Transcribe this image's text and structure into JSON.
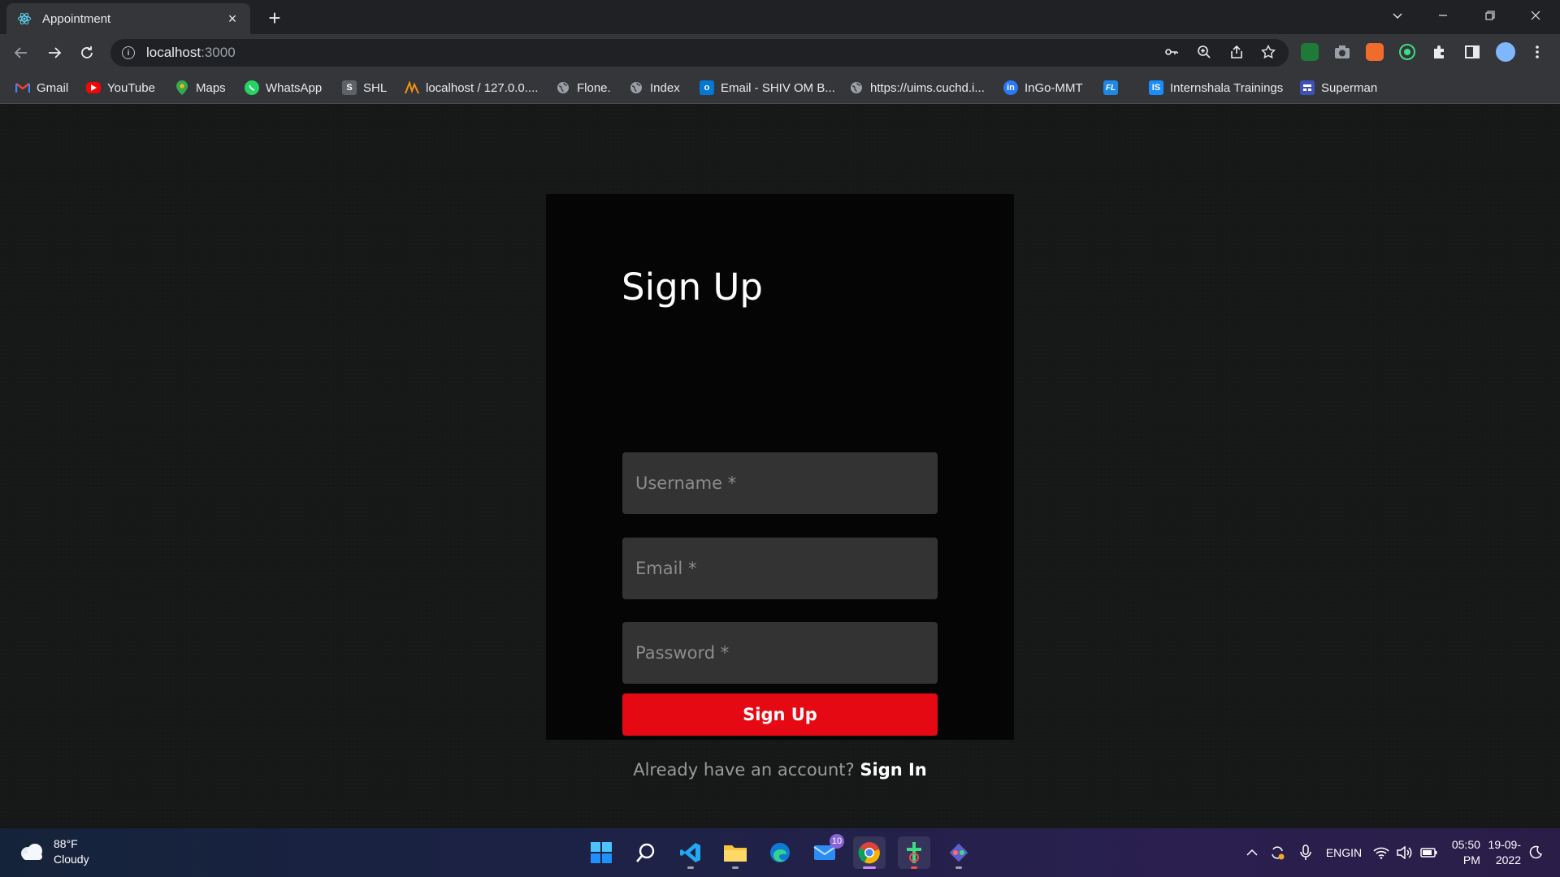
{
  "browser": {
    "tab_title": "Appointment",
    "tab_close": "×",
    "new_tab": "+",
    "url_host": "localhost",
    "url_port": ":3000"
  },
  "bookmarks": [
    {
      "label": "Gmail",
      "icon": "gmail-icon",
      "color": "#ea4335"
    },
    {
      "label": "YouTube",
      "icon": "youtube-icon",
      "color": "#ff0000"
    },
    {
      "label": "Maps",
      "icon": "maps-icon",
      "color": "#34a853"
    },
    {
      "label": "WhatsApp",
      "icon": "whatsapp-icon",
      "color": "#25d366"
    },
    {
      "label": "SHL",
      "icon": "shl-icon",
      "color": "#5f6368"
    },
    {
      "label": "localhost / 127.0.0....",
      "icon": "phpmyadmin-icon",
      "color": "#f29111"
    },
    {
      "label": "Flone.",
      "icon": "globe-icon",
      "color": "#9aa0a6"
    },
    {
      "label": "Index",
      "icon": "globe-icon",
      "color": "#9aa0a6"
    },
    {
      "label": "Email - SHIV OM B...",
      "icon": "outlook-icon",
      "color": "#0078d4"
    },
    {
      "label": "https://uims.cuchd.i...",
      "icon": "globe-icon",
      "color": "#9aa0a6"
    },
    {
      "label": "InGo-MMT",
      "icon": "ingo-icon",
      "color": "#2979ff"
    },
    {
      "label": "",
      "icon": "fl-icon",
      "color": "#1e88e5"
    },
    {
      "label": "Internshala Trainings",
      "icon": "internshala-icon",
      "color": "#1a8cff"
    },
    {
      "label": "Superman",
      "icon": "superman-icon",
      "color": "#3f51b5"
    }
  ],
  "form": {
    "title": "Sign Up",
    "username_placeholder": "Username *",
    "email_placeholder": "Email *",
    "password_placeholder": "Password *",
    "submit_label": "Sign Up",
    "account_prompt": "Already have an account?",
    "signin_link": "Sign In",
    "accent_color": "#e50914"
  },
  "taskbar": {
    "weather_temp": "88°F",
    "weather_desc": "Cloudy",
    "mail_badge": "10",
    "lang_top": "ENG",
    "lang_bottom": "IN",
    "time": "05:50 PM",
    "date": "19-09-2022"
  }
}
